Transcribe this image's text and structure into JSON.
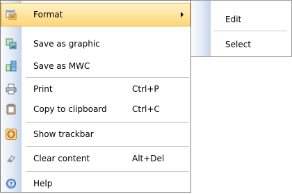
{
  "context_menu": {
    "items": [
      {
        "label": "Format",
        "shortcut": "",
        "icon": "format-icon",
        "has_submenu": true,
        "highlighted": true
      },
      {
        "label": "Save as graphic",
        "shortcut": "",
        "icon": "save-graphic-icon"
      },
      {
        "label": "Save as MWC",
        "shortcut": "",
        "icon": "save-mwc-icon"
      },
      {
        "label": "Print",
        "shortcut": "Ctrl+P",
        "icon": "printer-icon"
      },
      {
        "label": "Copy to clipboard",
        "shortcut": "Ctrl+C",
        "icon": "clipboard-icon"
      },
      {
        "label": "Show trackbar",
        "shortcut": "",
        "icon": "trackbar-icon"
      },
      {
        "label": "Clear content",
        "shortcut": "Alt+Del",
        "icon": "clear-icon"
      },
      {
        "label": "Help",
        "shortcut": "",
        "icon": "help-icon"
      }
    ]
  },
  "submenu": {
    "parent": "Format",
    "items": [
      {
        "label": "Edit"
      },
      {
        "label": "Select"
      }
    ]
  },
  "colors": {
    "highlight_top": "#fff3c9",
    "highlight_bottom": "#ffd675",
    "menu_border": "#7f7f7f",
    "separator": "#c5c5c5",
    "gutter": "#c6d3ea"
  }
}
